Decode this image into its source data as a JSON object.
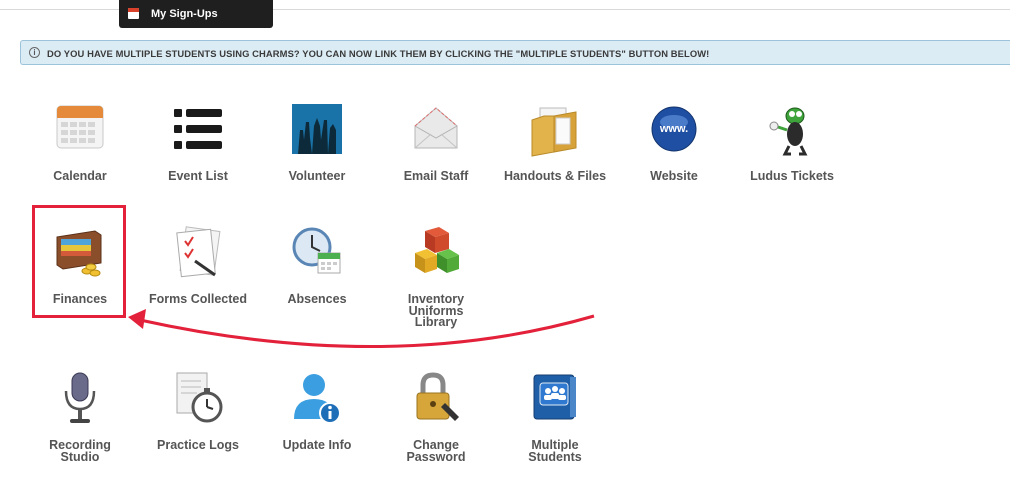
{
  "menu": {
    "my_signups": "My Sign-Ups"
  },
  "banner": {
    "text": "DO YOU HAVE MULTIPLE STUDENTS USING CHARMS? YOU CAN NOW LINK THEM BY CLICKING THE \"MULTIPLE STUDENTS\" BUTTON BELOW!",
    "info_glyph": "i"
  },
  "tiles": {
    "calendar": "Calendar",
    "event_list": "Event List",
    "volunteer": "Volunteer",
    "email_staff": "Email Staff",
    "handouts_files": "Handouts & Files",
    "website": "Website",
    "ludus_tickets": "Ludus Tickets",
    "finances": "Finances",
    "forms_collected": "Forms Collected",
    "absences": "Absences",
    "inventory": [
      "Inventory",
      "Uniforms",
      "Library"
    ],
    "recording_studio": [
      "Recording",
      "Studio"
    ],
    "practice_logs": "Practice Logs",
    "update_info": "Update Info",
    "change_password": [
      "Change",
      "Password"
    ],
    "multiple_students": [
      "Multiple",
      "Students"
    ]
  },
  "icon_text": {
    "website_globe": "www."
  },
  "colors": {
    "highlight": "#e3213a",
    "banner_bg": "#dcecf5",
    "label": "#555555"
  }
}
